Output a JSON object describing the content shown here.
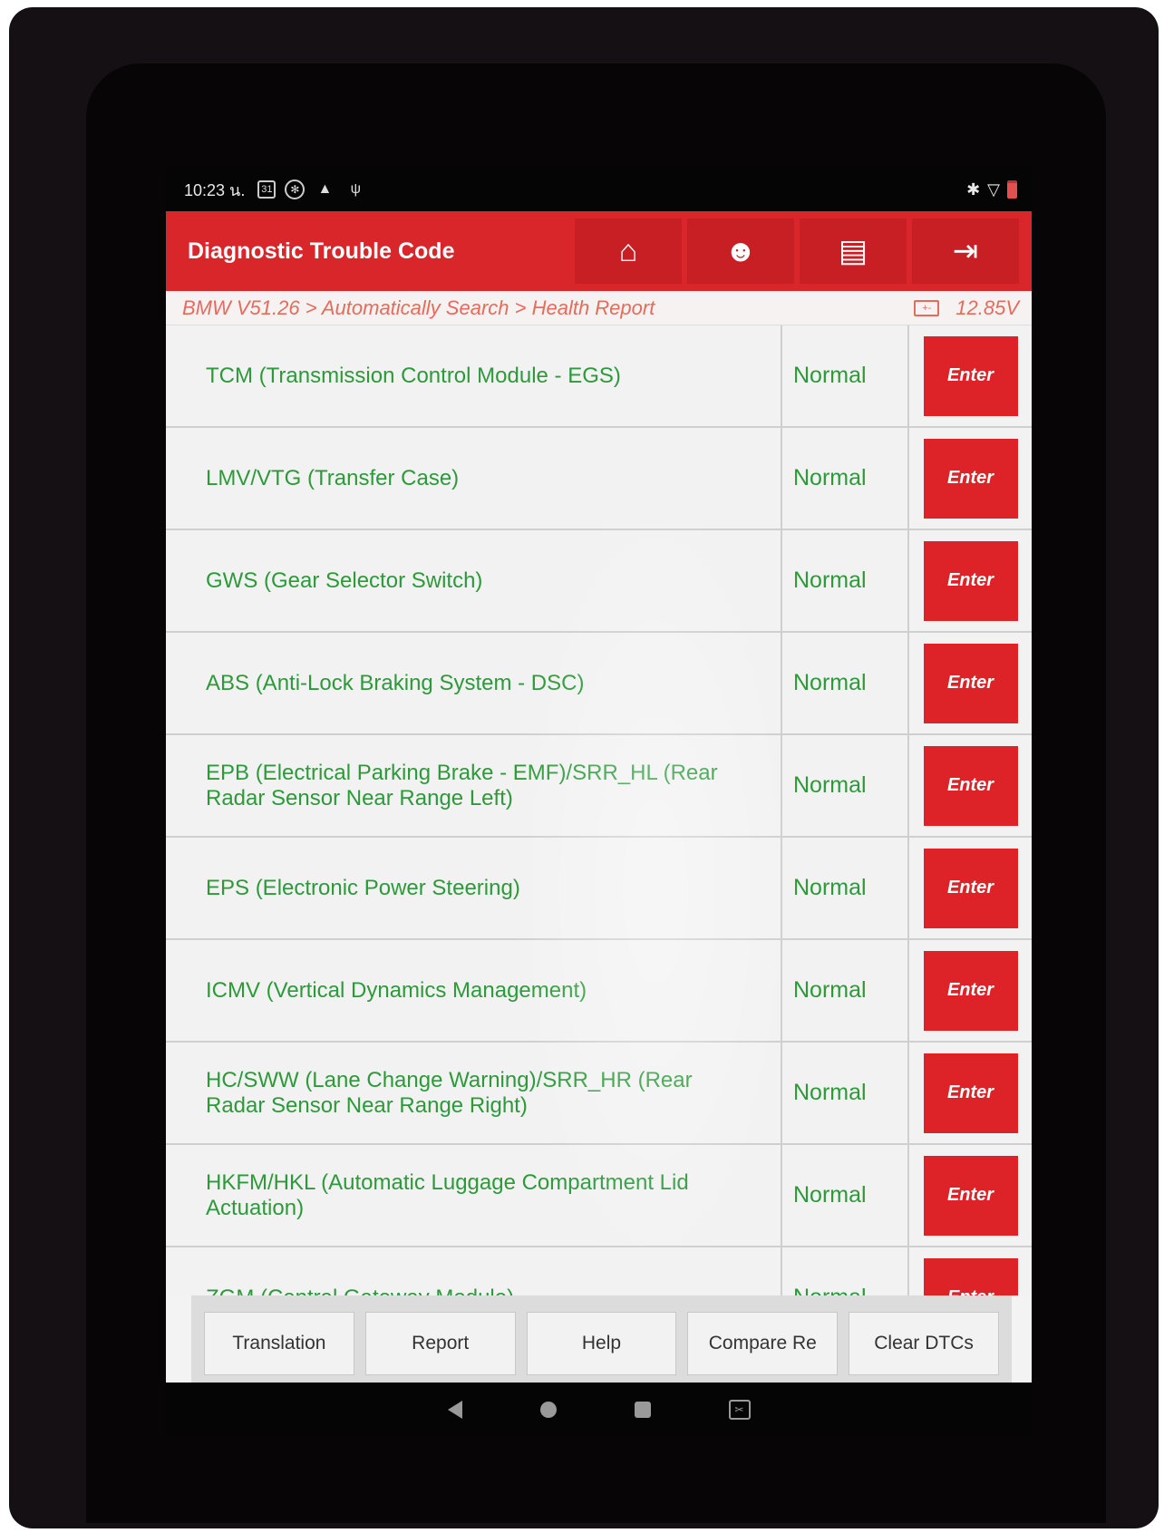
{
  "status_bar": {
    "time": "10:23 ",
    "time_suffix": "น.",
    "calendar_icon_text": "31"
  },
  "header": {
    "title": "Diagnostic Trouble Code",
    "tools": [
      "home-icon",
      "support-icon",
      "print-icon",
      "exit-icon"
    ]
  },
  "breadcrumb": {
    "path": "BMW V51.26 > Automatically Search > Health Report",
    "voltage": "12.85V"
  },
  "modules": [
    {
      "name": "TCM (Transmission Control Module - EGS)",
      "status": "Normal",
      "action": "Enter"
    },
    {
      "name": "LMV/VTG (Transfer Case)",
      "status": "Normal",
      "action": "Enter"
    },
    {
      "name": "GWS (Gear Selector Switch)",
      "status": "Normal",
      "action": "Enter"
    },
    {
      "name": "ABS (Anti-Lock Braking System - DSC)",
      "status": "Normal",
      "action": "Enter"
    },
    {
      "name": "EPB (Electrical Parking Brake - EMF)/SRR_HL (Rear Radar Sensor Near Range Left)",
      "status": "Normal",
      "action": "Enter"
    },
    {
      "name": "EPS (Electronic Power Steering)",
      "status": "Normal",
      "action": "Enter"
    },
    {
      "name": "ICMV (Vertical Dynamics Management)",
      "status": "Normal",
      "action": "Enter"
    },
    {
      "name": "HC/SWW (Lane Change Warning)/SRR_HR (Rear Radar Sensor Near Range Right)",
      "status": "Normal",
      "action": "Enter"
    },
    {
      "name": "HKFM/HKL (Automatic Luggage Compartment Lid Actuation)",
      "status": "Normal",
      "action": "Enter"
    },
    {
      "name": "ZGM (Central Gateway Module)",
      "status": "Normal",
      "action": "Enter"
    }
  ],
  "bottom_bar": {
    "translation": "Translation",
    "report": "Report",
    "help": "Help",
    "compare": "Compare Re",
    "clear": "Clear DTCs"
  },
  "colors": {
    "header_red": "#d9262b",
    "button_red": "#dd2327",
    "text_green": "#2d9a3a",
    "breadcrumb_orange": "#e56b5b"
  }
}
